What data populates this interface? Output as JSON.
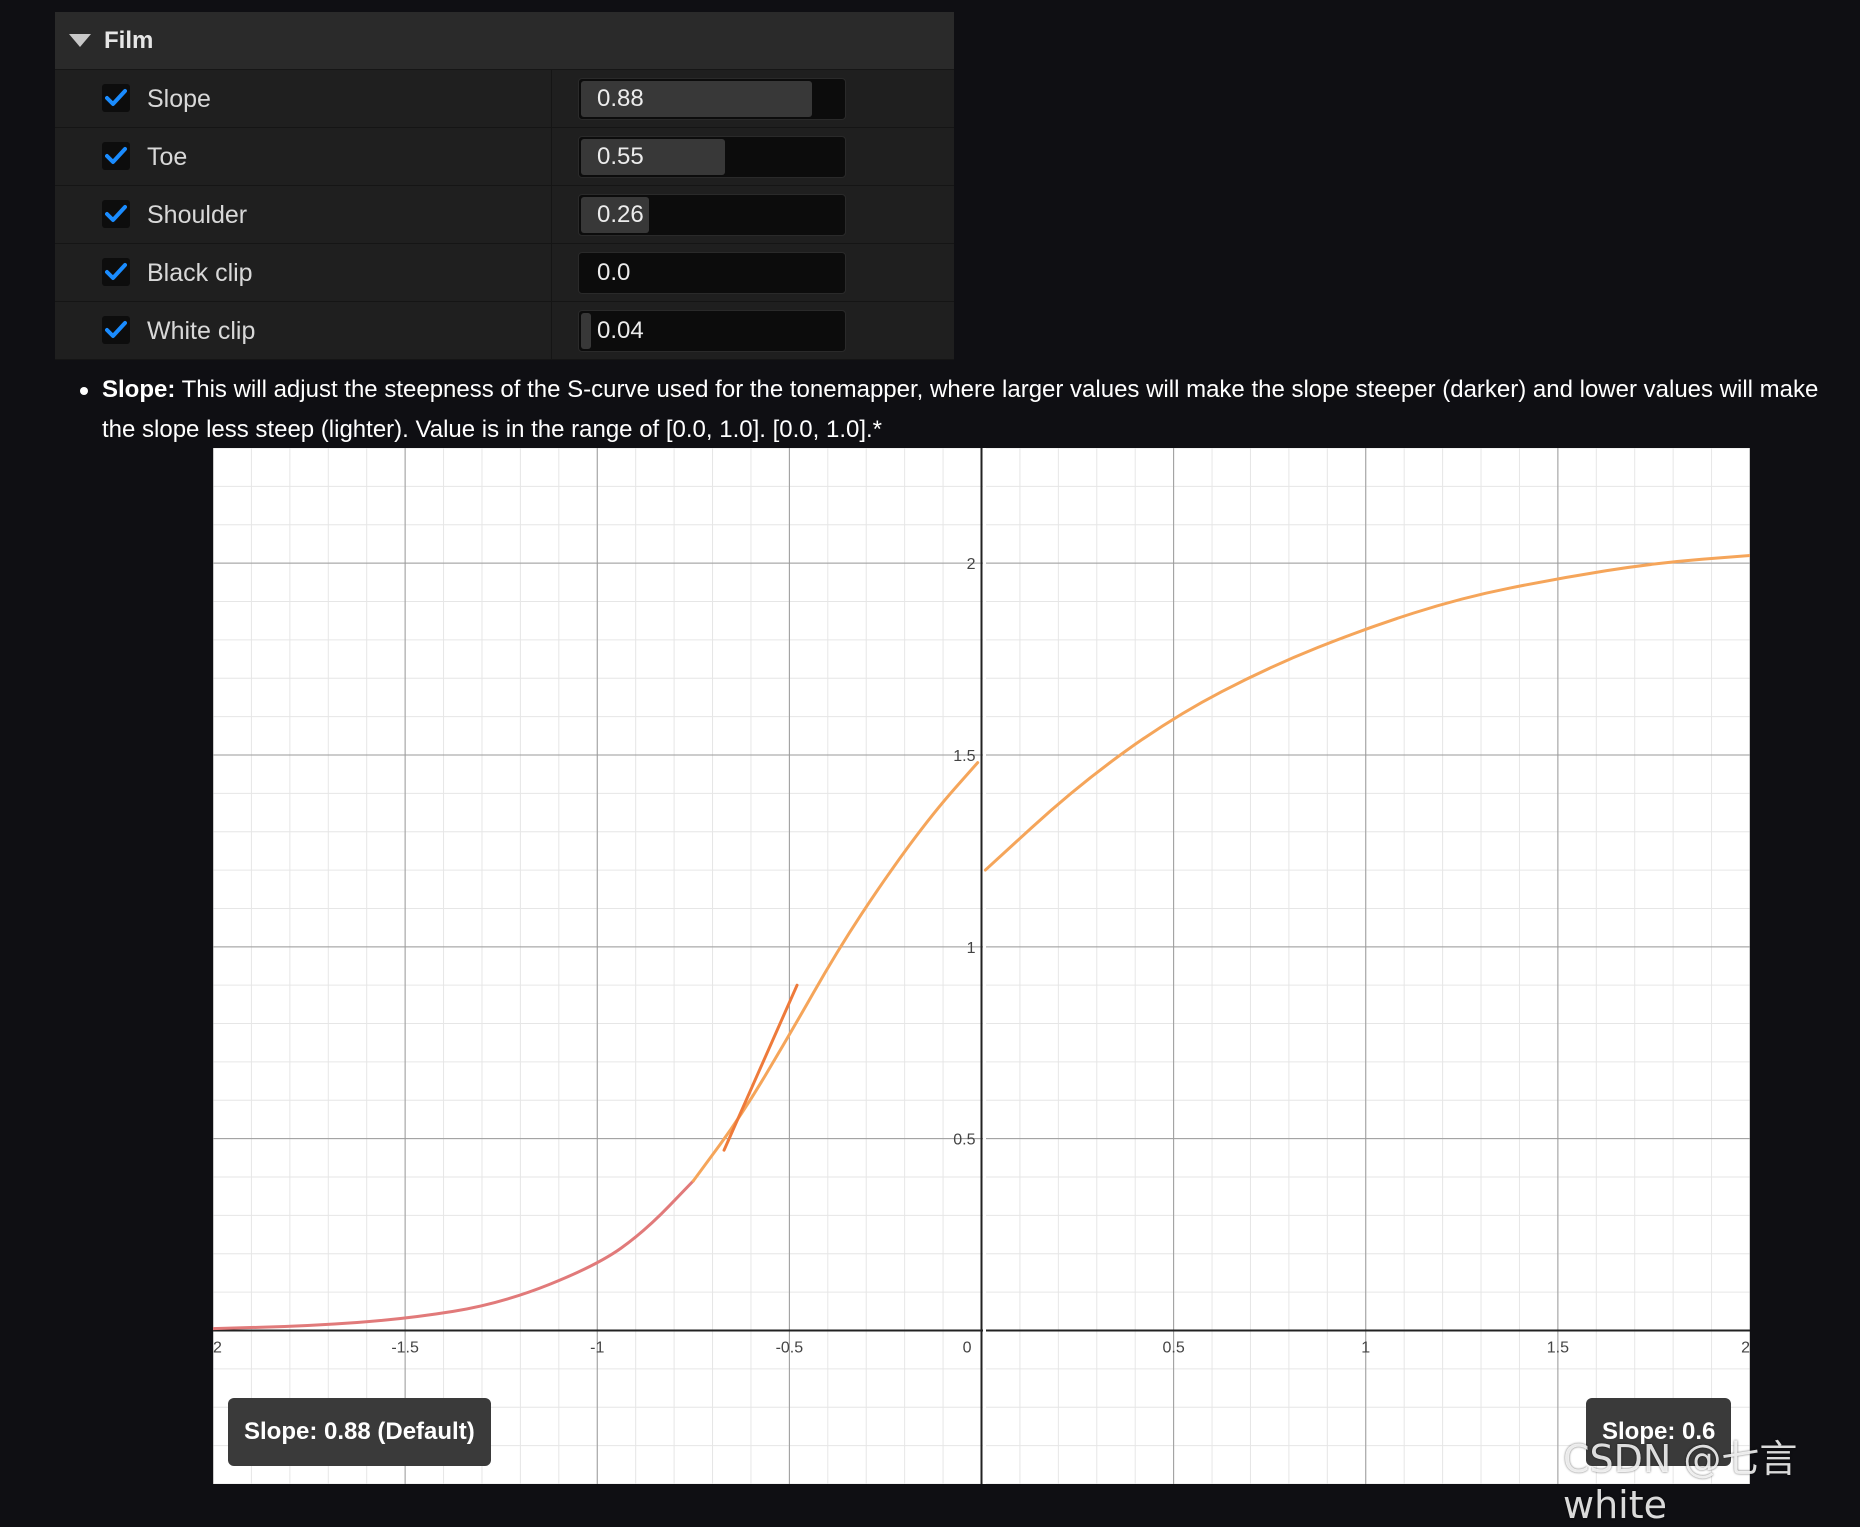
{
  "panel": {
    "title": "Film",
    "rows": [
      {
        "label": "Slope",
        "value": "0.88",
        "checked": true,
        "level": 0.88
      },
      {
        "label": "Toe",
        "value": "0.55",
        "checked": true,
        "level": 0.55
      },
      {
        "label": "Shoulder",
        "value": "0.26",
        "checked": true,
        "level": 0.26
      },
      {
        "label": "Black clip",
        "value": "0.0",
        "checked": true,
        "level": 0.0
      },
      {
        "label": "White clip",
        "value": "0.04",
        "checked": true,
        "level": 0.04
      }
    ]
  },
  "description": {
    "term": "Slope:",
    "text": " This will adjust the steepness of the S-curve used for the tonemapper, where larger values will make the slope steeper (darker) and lower values will make the slope less steep (lighter). Value is in the range of [0.0, 1.0]. [0.0, 1.0].*"
  },
  "chart_data": {
    "type": "line",
    "xlim": [
      -2,
      2
    ],
    "ylim": [
      -0.4,
      2.3
    ],
    "grid": true,
    "x_ticks": [
      "2",
      "-1.5",
      "-1",
      "-0.5",
      "0",
      "0.5",
      "1",
      "1.5",
      "2"
    ],
    "y_ticks": [
      "0.5",
      "1",
      "1.5",
      "2"
    ],
    "panels": [
      {
        "caption": "Slope: 0.88 (Default)",
        "series": [
          {
            "color": "#e17a7a",
            "x": [
              -2.0,
              -1.75,
              -1.5,
              -1.25,
              -1.0,
              -0.875,
              -0.75
            ],
            "y": [
              0.005,
              0.012,
              0.03,
              0.07,
              0.17,
              0.26,
              0.39
            ]
          },
          {
            "color": "#f5a55a",
            "x": [
              -0.75,
              -0.625,
              -0.5,
              -0.375,
              -0.25,
              -0.125,
              -0.01
            ],
            "y": [
              0.39,
              0.56,
              0.77,
              0.99,
              1.18,
              1.35,
              1.48
            ]
          },
          {
            "color": "#ee7a3a",
            "x": [
              -0.67,
              -0.48
            ],
            "y": [
              0.47,
              0.9
            ]
          }
        ]
      },
      {
        "caption": "Slope: 0.6",
        "series": [
          {
            "color": "#f5a55a",
            "x": [
              0.01,
              0.25,
              0.5,
              0.75,
              1.0,
              1.25,
              1.5,
              1.75,
              2.0
            ],
            "y": [
              1.2,
              1.42,
              1.6,
              1.73,
              1.83,
              1.91,
              1.96,
              2.0,
              2.02
            ]
          }
        ]
      }
    ]
  },
  "watermark": "CSDN @七言white",
  "colors": {
    "checkbox": "#1a8cff",
    "curve": "#f5a55a",
    "curve_dark": "#e17a7a"
  }
}
